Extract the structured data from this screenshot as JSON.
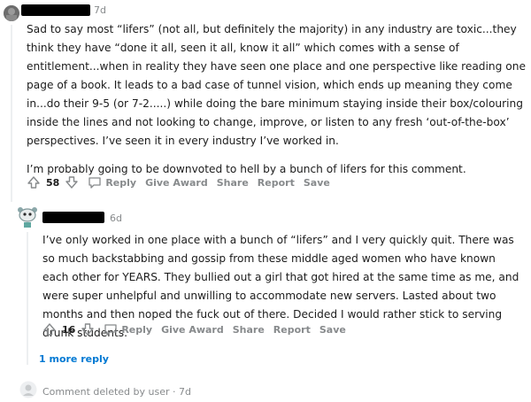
{
  "comment1": {
    "timestamp": "7d",
    "body": [
      "Sad to say most “lifers” (not all, but definitely the majority) in any industry are toxic...they think they have “done it all, seen it all, know it all” which comes with a sense of entitlement...when in reality they have seen one place and one perspective like reading one page of a book. It leads to a bad case of tunnel vision, which ends up meaning they come in...do their 9-5 (or 7-2.....) while doing the bare minimum staying inside their box/colouring inside the lines and not looking to change, improve, or listen to any fresh ‘out-of-the-box’ perspectives. I’ve seen it in every industry I’ve worked in.",
      "I’m probably going to be downvoted to hell by a bunch of lifers for this comment."
    ],
    "votes": "58",
    "actions": {
      "reply": "Reply",
      "award": "Give Award",
      "share": "Share",
      "report": "Report",
      "save": "Save"
    }
  },
  "comment2": {
    "timestamp": "6d",
    "body": "I’ve only worked in one place with a bunch of “lifers” and I very quickly quit. There was so much backstabbing and gossip from these middle aged women who have known each other for YEARS. They bullied out a girl that got hired at the same time as me, and were super unhelpful and unwilling to accommodate new servers. Lasted about two months and then noped the fuck out of there. Decided I would rather stick to serving drunk students.",
    "votes": "16",
    "actions": {
      "reply": "Reply",
      "award": "Give Award",
      "share": "Share",
      "report": "Report",
      "save": "Save"
    },
    "more_replies": "1 more reply"
  },
  "deleted": {
    "text": "Comment deleted by user · 7d"
  }
}
